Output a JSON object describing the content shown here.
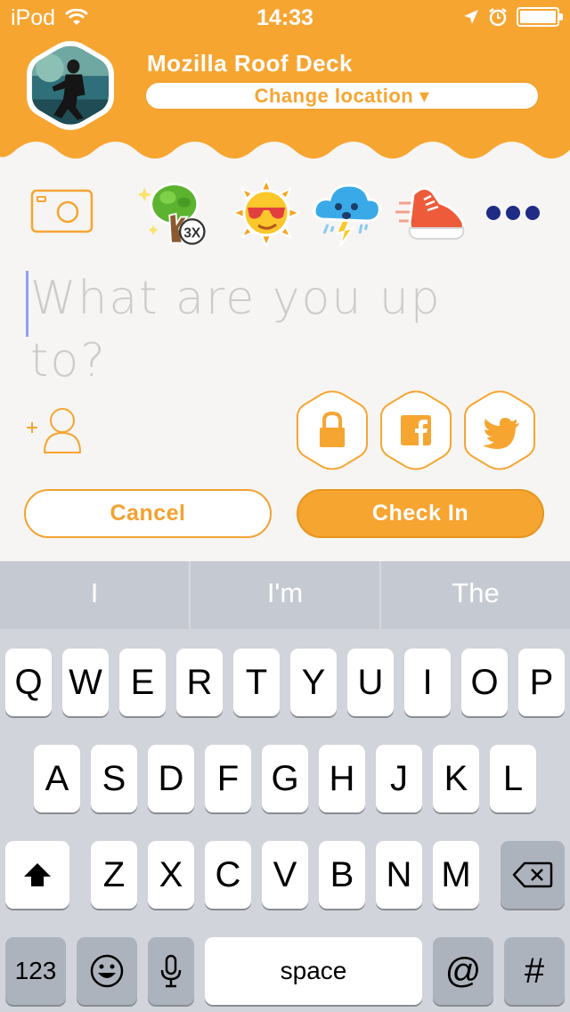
{
  "status_bar": {
    "carrier": "iPod",
    "time": "14:33",
    "battery_level": 1.0
  },
  "header": {
    "venue_name": "Mozilla Roof Deck",
    "change_location_label": "Change location ▾"
  },
  "stickers": [
    {
      "icon": "tree-sticker-icon",
      "badge": "3X"
    },
    {
      "icon": "sunglasses-sun-sticker-icon"
    },
    {
      "icon": "storm-cloud-sticker-icon"
    },
    {
      "icon": "running-shoe-sticker-icon"
    }
  ],
  "compose": {
    "placeholder": "What are you up to?",
    "value": ""
  },
  "share_icons": [
    "lock-icon",
    "facebook-icon",
    "twitter-icon"
  ],
  "actions": {
    "cancel_label": "Cancel",
    "checkin_label": "Check In"
  },
  "colors": {
    "accent": "#f7a531",
    "background": "#f6f5f4",
    "keyboard_bg": "#d1d4da"
  },
  "keyboard": {
    "predictions": [
      "I",
      "I'm",
      "The"
    ],
    "row1": [
      "Q",
      "W",
      "E",
      "R",
      "T",
      "Y",
      "U",
      "I",
      "O",
      "P"
    ],
    "row2": [
      "A",
      "S",
      "D",
      "F",
      "G",
      "H",
      "J",
      "K",
      "L"
    ],
    "row3": [
      "Z",
      "X",
      "C",
      "V",
      "B",
      "N",
      "M"
    ],
    "numbers_label": "123",
    "space_label": "space",
    "at_label": "@",
    "hash_label": "#"
  }
}
